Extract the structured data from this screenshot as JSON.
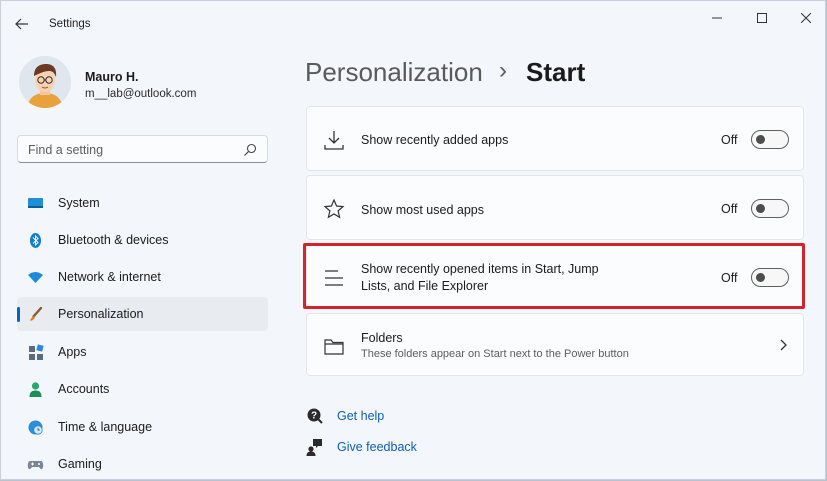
{
  "window": {
    "title": "Settings"
  },
  "profile": {
    "name": "Mauro H.",
    "email": "m__lab@outlook.com"
  },
  "search": {
    "placeholder": "Find a setting"
  },
  "nav": [
    {
      "label": "System",
      "icon": "system-icon"
    },
    {
      "label": "Bluetooth & devices",
      "icon": "bluetooth-icon"
    },
    {
      "label": "Network & internet",
      "icon": "wifi-icon"
    },
    {
      "label": "Personalization",
      "icon": "brush-icon",
      "active": true
    },
    {
      "label": "Apps",
      "icon": "apps-icon"
    },
    {
      "label": "Accounts",
      "icon": "accounts-icon"
    },
    {
      "label": "Time & language",
      "icon": "globe-clock-icon"
    },
    {
      "label": "Gaming",
      "icon": "gamepad-icon"
    }
  ],
  "breadcrumb": {
    "parent": "Personalization",
    "separator": "›",
    "current": "Start"
  },
  "settings": [
    {
      "title": "Show recently added apps",
      "state": "Off",
      "icon": "download-icon"
    },
    {
      "title": "Show most used apps",
      "state": "Off",
      "icon": "star-icon"
    },
    {
      "title_line1": "Show recently opened items in Start, Jump",
      "title_line2": "Lists, and File Explorer",
      "state": "Off",
      "icon": "list-icon"
    },
    {
      "title": "Folders",
      "subtitle": "These folders appear on Start next to the Power button",
      "icon": "folder-icon"
    }
  ],
  "links": {
    "help": "Get help",
    "feedback": "Give feedback"
  },
  "colors": {
    "accent": "#0067c0",
    "highlight": "#d1252e",
    "link": "#0f5fb6"
  }
}
